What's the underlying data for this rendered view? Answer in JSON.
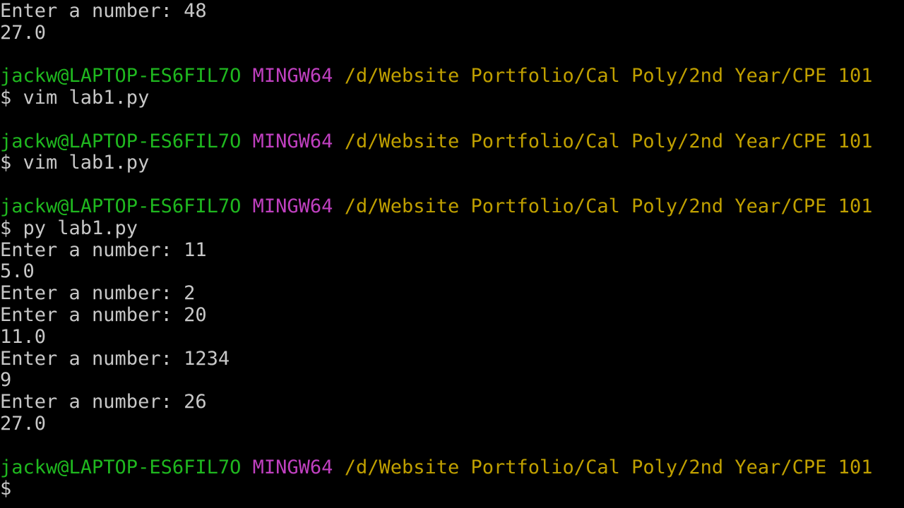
{
  "colors": {
    "background": "#000000",
    "text": "#c8c8c8",
    "user_host": "#1fb81f",
    "system": "#c040c0",
    "path": "#c0a000"
  },
  "prompt": {
    "user_host": "jackw@LAPTOP-ES6FIL7O",
    "system": "MINGW64",
    "path": "/d/Website Portfolio/Cal Poly/2nd Year/CPE 101"
  },
  "lines": [
    {
      "type": "text",
      "text": "$"
    },
    {
      "type": "text",
      "text": "Enter a number: 48"
    },
    {
      "type": "text",
      "text": "27.0"
    },
    {
      "type": "text",
      "text": ""
    },
    {
      "type": "prompt"
    },
    {
      "type": "text",
      "text": "$ vim lab1.py"
    },
    {
      "type": "text",
      "text": ""
    },
    {
      "type": "prompt"
    },
    {
      "type": "text",
      "text": "$ vim lab1.py"
    },
    {
      "type": "text",
      "text": ""
    },
    {
      "type": "prompt"
    },
    {
      "type": "text",
      "text": "$ py lab1.py"
    },
    {
      "type": "text",
      "text": "Enter a number: 11"
    },
    {
      "type": "text",
      "text": "5.0"
    },
    {
      "type": "text",
      "text": "Enter a number: 2"
    },
    {
      "type": "text",
      "text": "Enter a number: 20"
    },
    {
      "type": "text",
      "text": "11.0"
    },
    {
      "type": "text",
      "text": "Enter a number: 1234"
    },
    {
      "type": "text",
      "text": "9"
    },
    {
      "type": "text",
      "text": "Enter a number: 26"
    },
    {
      "type": "text",
      "text": "27.0"
    },
    {
      "type": "text",
      "text": ""
    },
    {
      "type": "prompt"
    },
    {
      "type": "text",
      "text": "$"
    }
  ]
}
